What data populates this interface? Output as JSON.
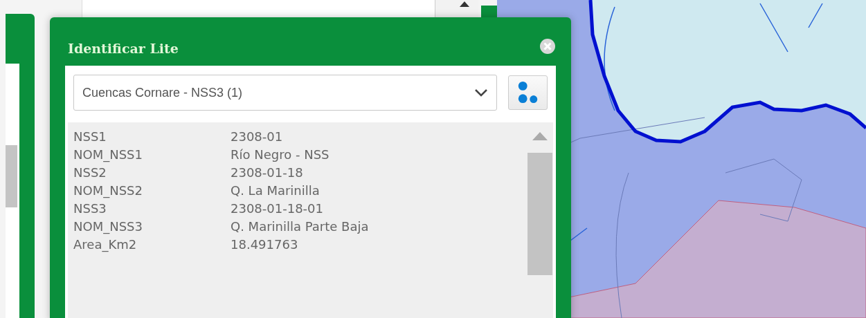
{
  "dialog": {
    "title": "Identificar Lite",
    "layer_select": {
      "value": "Cuencas Cornare - NSS3 (1)"
    },
    "attributes": [
      {
        "name": "NSS1",
        "value": "2308-01"
      },
      {
        "name": "NOM_NSS1",
        "value": "Río Negro - NSS"
      },
      {
        "name": "NSS2",
        "value": "2308-01-18"
      },
      {
        "name": "NOM_NSS2",
        "value": "Q. La Marinilla"
      },
      {
        "name": "NSS3",
        "value": "2308-01-18-01"
      },
      {
        "name": "NOM_NSS3",
        "value": "Q. Marinilla Parte Baja"
      },
      {
        "name": "Area_Km2",
        "value": "18.491763"
      }
    ]
  }
}
